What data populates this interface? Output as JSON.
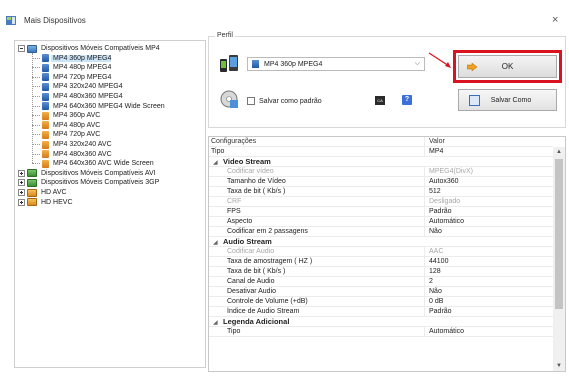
{
  "window": {
    "title": "Mais Dispositivos",
    "close_glyph": "×",
    "app_icon": "devices-app-icon"
  },
  "tree": {
    "root": "Dispositivos Móveis Compatíveis MP4",
    "children": [
      {
        "label": "MP4 360p MPEG4",
        "icon": "blue",
        "selected": true
      },
      {
        "label": "MP4 480p MPEG4",
        "icon": "blue"
      },
      {
        "label": "MP4 720p MPEG4",
        "icon": "blue"
      },
      {
        "label": "MP4 320x240 MPEG4",
        "icon": "blue"
      },
      {
        "label": "MP4 480x360 MPEG4",
        "icon": "blue"
      },
      {
        "label": "MP4 640x360 MPEG4 Wide Screen",
        "icon": "blue"
      },
      {
        "label": "MP4 360p AVC",
        "icon": "orange"
      },
      {
        "label": "MP4 480p AVC",
        "icon": "orange"
      },
      {
        "label": "MP4 720p AVC",
        "icon": "orange"
      },
      {
        "label": "MP4 320x240 AVC",
        "icon": "orange"
      },
      {
        "label": "MP4 480x360 AVC",
        "icon": "orange"
      },
      {
        "label": "MP4 640x360 AVC Wide Screen",
        "icon": "orange"
      }
    ],
    "collapsed": [
      {
        "label": "Dispositivos Móveis Compatíveis AVI",
        "icon": "folder-green"
      },
      {
        "label": "Dispositivos Móveis Compatíveis 3GP",
        "icon": "folder-green"
      },
      {
        "label": "HD AVC",
        "icon": "folder-orange"
      },
      {
        "label": "HD HEVC",
        "icon": "folder-orange"
      }
    ]
  },
  "perfil": {
    "legend": "Perfil",
    "selected_profile": "MP4 360p MPEG4",
    "save_default_label": "Salvar como padrão",
    "ok_label": "OK",
    "save_as_label": "Salvar Como",
    "ca_badge": "CA",
    "help_glyph": "?",
    "highlight_color": "#d9131f"
  },
  "grid": {
    "header": {
      "key": "Configurações",
      "value": "Valor"
    },
    "rows": [
      {
        "type": "top",
        "key": "Tipo",
        "value": "MP4"
      },
      {
        "type": "group",
        "key": "Video Stream",
        "value": ""
      },
      {
        "type": "disabled",
        "key": "Codificar vídeo",
        "value": "MPEG4(DivX)"
      },
      {
        "type": "normal",
        "key": "Tamanho de Vídeo",
        "value": "Autox360"
      },
      {
        "type": "normal",
        "key": "Taxa de bit ( Kb/s )",
        "value": "512"
      },
      {
        "type": "disabled",
        "key": "CRF",
        "value": "Desligado"
      },
      {
        "type": "normal",
        "key": "FPS",
        "value": "Padrão"
      },
      {
        "type": "normal",
        "key": "Aspecto",
        "value": "Automático"
      },
      {
        "type": "normal",
        "key": "Codificar em 2 passagens",
        "value": "Não"
      },
      {
        "type": "group",
        "key": "Audio Stream",
        "value": ""
      },
      {
        "type": "disabled",
        "key": "Codificar Audio",
        "value": "AAC"
      },
      {
        "type": "normal",
        "key": "Taxa de amostragem ( HZ )",
        "value": "44100"
      },
      {
        "type": "normal",
        "key": "Taxa de bit ( Kb/s )",
        "value": "128"
      },
      {
        "type": "normal",
        "key": "Canal de Audio",
        "value": "2"
      },
      {
        "type": "normal",
        "key": "Desativar Audio",
        "value": "Não"
      },
      {
        "type": "normal",
        "key": "Controle de Volume (+dB)",
        "value": "0 dB"
      },
      {
        "type": "normal",
        "key": "Índice de Audio Stream",
        "value": "Padrão"
      },
      {
        "type": "group",
        "key": "Legenda Adicional",
        "value": ""
      },
      {
        "type": "normal",
        "key": "Tipo",
        "value": "Automático"
      }
    ]
  }
}
